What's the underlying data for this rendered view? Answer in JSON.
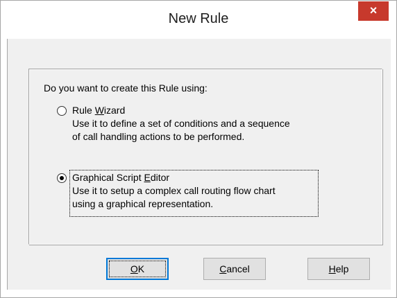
{
  "window": {
    "title": "New Rule",
    "close_glyph": "×"
  },
  "dialog": {
    "question": "Do you want to create this Rule using:",
    "options": [
      {
        "label_prefix": "Rule ",
        "label_accel": "W",
        "label_suffix": "izard",
        "description_line1": "Use it to define a set of conditions and a sequence",
        "description_line2": "of call handling actions to be performed.",
        "selected": false
      },
      {
        "label_prefix": "Graphical Script ",
        "label_accel": "E",
        "label_suffix": "ditor",
        "description_line1": "Use it to setup a complex call routing flow chart",
        "description_line2": "using a graphical representation.",
        "selected": true
      }
    ]
  },
  "buttons": {
    "ok": {
      "accel": "O",
      "rest": "K"
    },
    "cancel": {
      "accel": "C",
      "rest": "ancel"
    },
    "help": {
      "accel": "H",
      "rest": "elp"
    }
  },
  "colors": {
    "close_button": "#c7392c",
    "dialog_background": "#f0f0f0",
    "focus_border": "#0078d7"
  }
}
